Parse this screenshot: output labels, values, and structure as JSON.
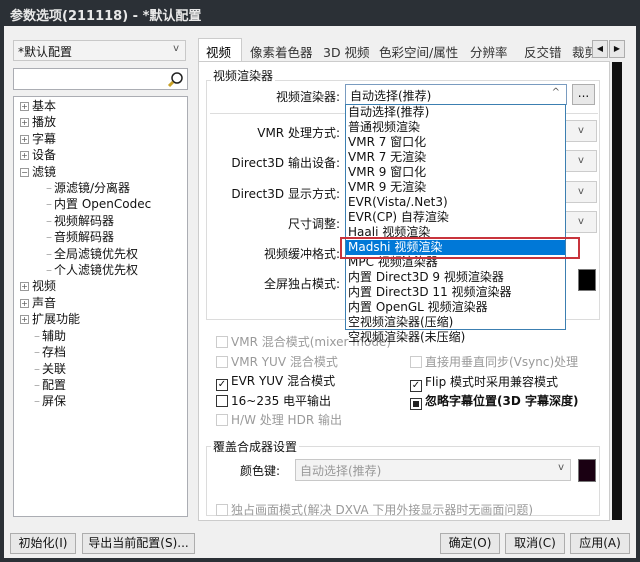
{
  "window": {
    "title": "参数选项(211118) - *默认配置"
  },
  "sidebar": {
    "profile": "*默认配置",
    "search_placeholder": "",
    "tree": [
      {
        "label": "基本",
        "type": "plus"
      },
      {
        "label": "播放",
        "type": "plus"
      },
      {
        "label": "字幕",
        "type": "plus"
      },
      {
        "label": "设备",
        "type": "plus"
      },
      {
        "label": "滤镜",
        "type": "minus"
      },
      {
        "label": "源滤镜/分离器",
        "type": "child"
      },
      {
        "label": "内置 OpenCodec",
        "type": "child"
      },
      {
        "label": "视频解码器",
        "type": "child"
      },
      {
        "label": "音频解码器",
        "type": "child"
      },
      {
        "label": "全局滤镜优先权",
        "type": "child"
      },
      {
        "label": "个人滤镜优先权",
        "type": "child"
      },
      {
        "label": "视频",
        "type": "plus"
      },
      {
        "label": "声音",
        "type": "plus"
      },
      {
        "label": "扩展功能",
        "type": "plus"
      },
      {
        "label": "辅助",
        "type": "leaf"
      },
      {
        "label": "存档",
        "type": "leaf"
      },
      {
        "label": "关联",
        "type": "leaf"
      },
      {
        "label": "配置",
        "type": "leaf"
      },
      {
        "label": "屏保",
        "type": "leaf"
      }
    ]
  },
  "tabs": [
    "视频",
    "像素着色器",
    "3D 视频",
    "色彩空间/属性",
    "分辨率",
    "反交错",
    "裁剪"
  ],
  "renderer": {
    "group": "视频渲染器",
    "label": "视频渲染器:",
    "value": "自动选择(推荐)",
    "more": "...",
    "rows": [
      "VMR 处理方式:",
      "Direct3D 输出设备:",
      "Direct3D 显示方式:",
      "尺寸调整:",
      "视频缓冲格式:",
      "全屏独占模式:"
    ],
    "size_partial": "择"
  },
  "dropdown": {
    "items": [
      "自动选择(推荐)",
      "普通视频渲染",
      "VMR 7 窗口化",
      "VMR 7 无渲染",
      "VMR 9 窗口化",
      "VMR 9 无渲染",
      "EVR(Vista/.Net3)",
      "EVR(CP) 自荐渲染",
      "Haali 视频渲染",
      "Madshi 视频渲染",
      "MPC 视频渲染器",
      "内置 Direct3D 9 视频渲染器",
      "内置 Direct3D 11 视频渲染器",
      "内置 OpenGL 视频渲染器",
      "空视频渲染器(压缩)",
      "空视频渲染器(未压缩)"
    ],
    "selected": "Madshi 视频渲染"
  },
  "options_left": [
    {
      "label": "VMR 混合模式(mixer mode)",
      "state": "disabled"
    },
    {
      "label": "VMR YUV 混合模式",
      "state": "disabled"
    },
    {
      "label": "EVR YUV 混合模式",
      "state": "checked"
    },
    {
      "label": "16~235 电平输出",
      "state": "unchecked"
    },
    {
      "label": "H/W 处理 HDR 输出",
      "state": "disabled"
    }
  ],
  "options_right": [
    {
      "label": "直接用垂直同步(Vsync)处理",
      "state": "disabled"
    },
    {
      "label": "Flip 模式时采用兼容模式",
      "state": "checked"
    },
    {
      "label": "忽略字幕位置(3D 字幕深度)",
      "state": "indeterminate"
    }
  ],
  "overlay": {
    "group": "覆盖合成器设置",
    "color_key_label": "颜色键:",
    "color_key_value": "自动选择(推荐)",
    "swatch": "#1a0012",
    "exclusive": "独占画面模式(解决 DXVA 下用外接显示器时无画面问题)"
  },
  "buttons": {
    "init": "初始化(I)",
    "export": "导出当前配置(S)...",
    "ok": "确定(O)",
    "cancel": "取消(C)",
    "apply": "应用(A)"
  }
}
